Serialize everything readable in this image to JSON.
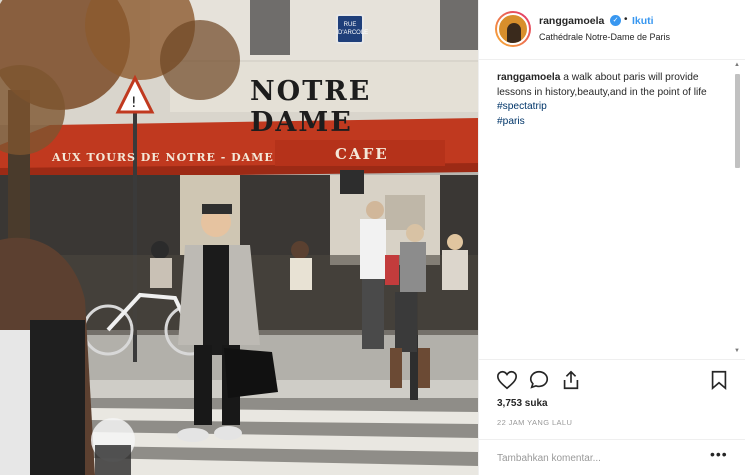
{
  "photo": {
    "sign_main": "NOTRE DAME",
    "awning_left": "AUX TOURS DE NOTRE - DAME",
    "awning_cafe": "CAFE",
    "street_sign": "RUE D'ARCOLE"
  },
  "post": {
    "username": "ranggamoela",
    "follow_label": "Ikuti",
    "location": "Cathédrale Notre-Dame de Paris",
    "caption": {
      "username": "ranggamoela",
      "text": "a walk about paris will provide lessons in history,beauty,and in the point of life",
      "hashtags": [
        "#spectatrip",
        "#paris"
      ]
    },
    "likes": "3,753 suka",
    "time": "22 JAM YANG LALU",
    "comment_placeholder": "Tambahkan komentar...",
    "more_label": "•••"
  },
  "icons": {
    "like": "heart-icon",
    "comment": "comment-icon",
    "share": "share-icon",
    "save": "bookmark-icon",
    "verified": "verified-badge-icon"
  },
  "colors": {
    "accent_blue": "#3897f0",
    "hashtag": "#003569",
    "awning_red": "#c0391f",
    "muted": "#999999"
  }
}
